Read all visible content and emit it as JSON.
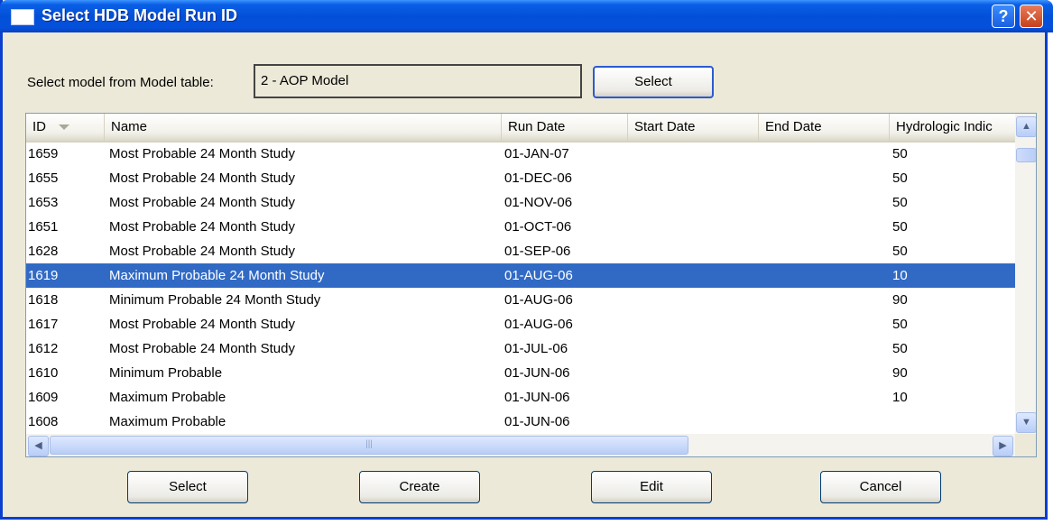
{
  "window": {
    "title": "Select HDB Model Run ID"
  },
  "title_buttons": {
    "help": "?",
    "close": "✕"
  },
  "model": {
    "label": "Select model from Model table:",
    "value": "2 - AOP Model",
    "select_button": "Select"
  },
  "table": {
    "columns": [
      "ID",
      "Name",
      "Run Date",
      "Start Date",
      "End Date",
      "Hydrologic Indic"
    ],
    "rows": [
      {
        "id": "1659",
        "name": "Most Probable 24 Month Study",
        "run": "01-JAN-07",
        "start": "",
        "end": "",
        "hyd": "50"
      },
      {
        "id": "1655",
        "name": "Most Probable 24 Month Study",
        "run": "01-DEC-06",
        "start": "",
        "end": "",
        "hyd": "50"
      },
      {
        "id": "1653",
        "name": "Most Probable 24 Month Study",
        "run": "01-NOV-06",
        "start": "",
        "end": "",
        "hyd": "50"
      },
      {
        "id": "1651",
        "name": "Most Probable 24 Month Study",
        "run": "01-OCT-06",
        "start": "",
        "end": "",
        "hyd": "50"
      },
      {
        "id": "1628",
        "name": "Most Probable 24 Month Study",
        "run": "01-SEP-06",
        "start": "",
        "end": "",
        "hyd": "50"
      },
      {
        "id": "1619",
        "name": "Maximum Probable 24 Month Study",
        "run": "01-AUG-06",
        "start": "",
        "end": "",
        "hyd": "10",
        "selected": true
      },
      {
        "id": "1618",
        "name": "Minimum Probable 24 Month Study",
        "run": "01-AUG-06",
        "start": "",
        "end": "",
        "hyd": "90"
      },
      {
        "id": "1617",
        "name": "Most Probable 24 Month Study",
        "run": "01-AUG-06",
        "start": "",
        "end": "",
        "hyd": "50"
      },
      {
        "id": "1612",
        "name": "Most Probable 24 Month Study",
        "run": "01-JUL-06",
        "start": "",
        "end": "",
        "hyd": "50"
      },
      {
        "id": "1610",
        "name": "Minimum Probable",
        "run": "01-JUN-06",
        "start": "",
        "end": "",
        "hyd": "90"
      },
      {
        "id": "1609",
        "name": "Maximum Probable",
        "run": "01-JUN-06",
        "start": "",
        "end": "",
        "hyd": "10"
      },
      {
        "id": "1608",
        "name": "Maximum Probable",
        "run": "01-JUN-06",
        "start": "",
        "end": "",
        "hyd": ""
      }
    ],
    "scrollbar_glyphs": {
      "up": "▲",
      "down": "▼",
      "left": "◀",
      "right": "▶",
      "grip": "|||"
    }
  },
  "buttons": {
    "select": "Select",
    "create": "Create",
    "edit": "Edit",
    "cancel": "Cancel"
  },
  "colors": {
    "titlebar": "#0350d8",
    "selection": "#316ac5",
    "window_bg": "#ece9d8"
  }
}
